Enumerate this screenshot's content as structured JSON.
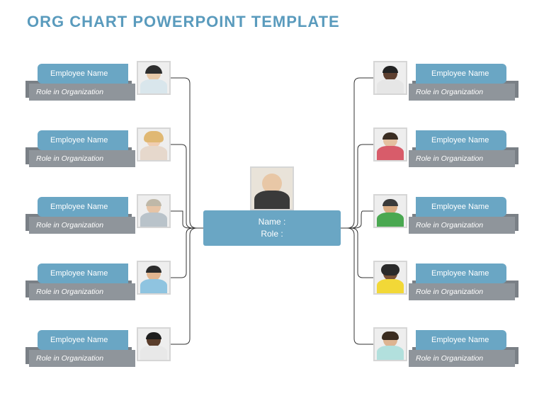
{
  "title": "ORG CHART POWERPOINT TEMPLATE",
  "center": {
    "name_label": "Name :",
    "role_label": "Role :"
  },
  "left": [
    {
      "name": "Employee Name",
      "role": "Role in Organization",
      "skin": "#e8c9a8",
      "hair": "#2e2e2e",
      "shirt": "#d9e6ec"
    },
    {
      "name": "Employee Name",
      "role": "Role in Organization",
      "skin": "#f0cdb0",
      "hair": "#e0b873",
      "shirt": "#e6d8cc"
    },
    {
      "name": "Employee Name",
      "role": "Role in Organization",
      "skin": "#e6c4a6",
      "hair": "#bfb8a8",
      "shirt": "#b9c3ca"
    },
    {
      "name": "Employee Name",
      "role": "Role in Organization",
      "skin": "#e2b690",
      "hair": "#2b2b2b",
      "shirt": "#8fc4e0"
    },
    {
      "name": "Employee Name",
      "role": "Role in Organization",
      "skin": "#5a3d2b",
      "hair": "#1e1e1e",
      "shirt": "#e8e8e8"
    }
  ],
  "right": [
    {
      "name": "Employee Name",
      "role": "Role in Organization",
      "skin": "#5e4030",
      "hair": "#232323",
      "shirt": "#e6e6e6"
    },
    {
      "name": "Employee Name",
      "role": "Role in Organization",
      "skin": "#e4c0a0",
      "hair": "#3a2d22",
      "shirt": "#d85c6a"
    },
    {
      "name": "Employee Name",
      "role": "Role in Organization",
      "skin": "#d8ab82",
      "hair": "#3a3a3a",
      "shirt": "#4aa851"
    },
    {
      "name": "Employee Name",
      "role": "Role in Organization",
      "skin": "#7a5238",
      "hair": "#2a2a2a",
      "shirt": "#f2d837"
    },
    {
      "name": "Employee Name",
      "role": "Role in Organization",
      "skin": "#ddb491",
      "hair": "#3a2c20",
      "shirt": "#b2e0dd"
    }
  ]
}
